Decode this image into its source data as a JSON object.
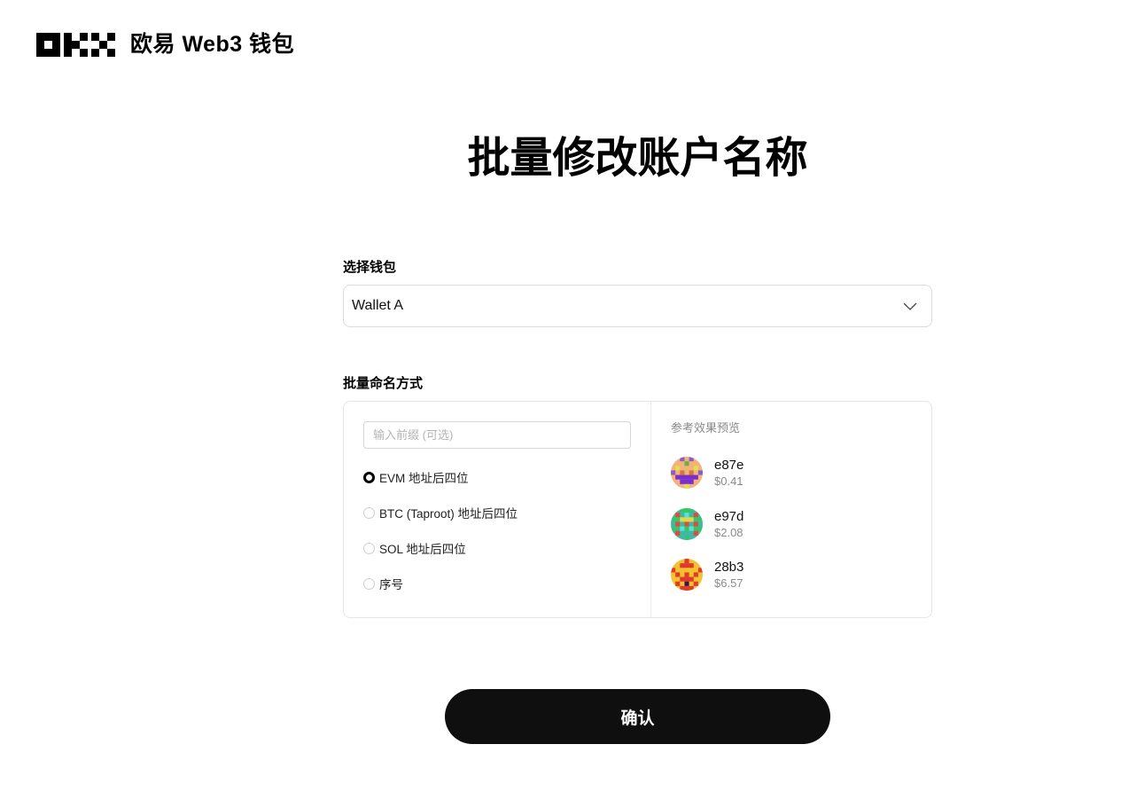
{
  "header": {
    "logo_icon": "okx-logo-icon",
    "brand_name": "欧易 Web3 钱包"
  },
  "page_title": "批量修改账户名称",
  "wallet_section": {
    "label": "选择钱包",
    "selected_value": "Wallet A",
    "dropdown_icon": "chevron-down-icon"
  },
  "naming_section": {
    "label": "批量命名方式",
    "prefix_input": {
      "value": "",
      "placeholder": "输入前缀 (可选)"
    },
    "options": [
      {
        "label": "EVM 地址后四位",
        "checked": true
      },
      {
        "label": "BTC (Taproot) 地址后四位",
        "checked": false
      },
      {
        "label": "SOL 地址后四位",
        "checked": false
      },
      {
        "label": "序号",
        "checked": false
      }
    ],
    "preview": {
      "title": "参考效果预览",
      "accounts": [
        {
          "name": "e87e",
          "balance": "$0.41",
          "avatar_icon": "pixel-avatar-icon"
        },
        {
          "name": "e97d",
          "balance": "$2.08",
          "avatar_icon": "pixel-avatar-icon"
        },
        {
          "name": "28b3",
          "balance": "$6.57",
          "avatar_icon": "pixel-avatar-icon"
        }
      ]
    }
  },
  "confirm_button": {
    "label": "确认"
  },
  "colors": {
    "button_bg": "#0f0f0f",
    "button_text": "#ffffff",
    "border": "#dcdcdc",
    "muted_text": "#8a8a8a"
  }
}
